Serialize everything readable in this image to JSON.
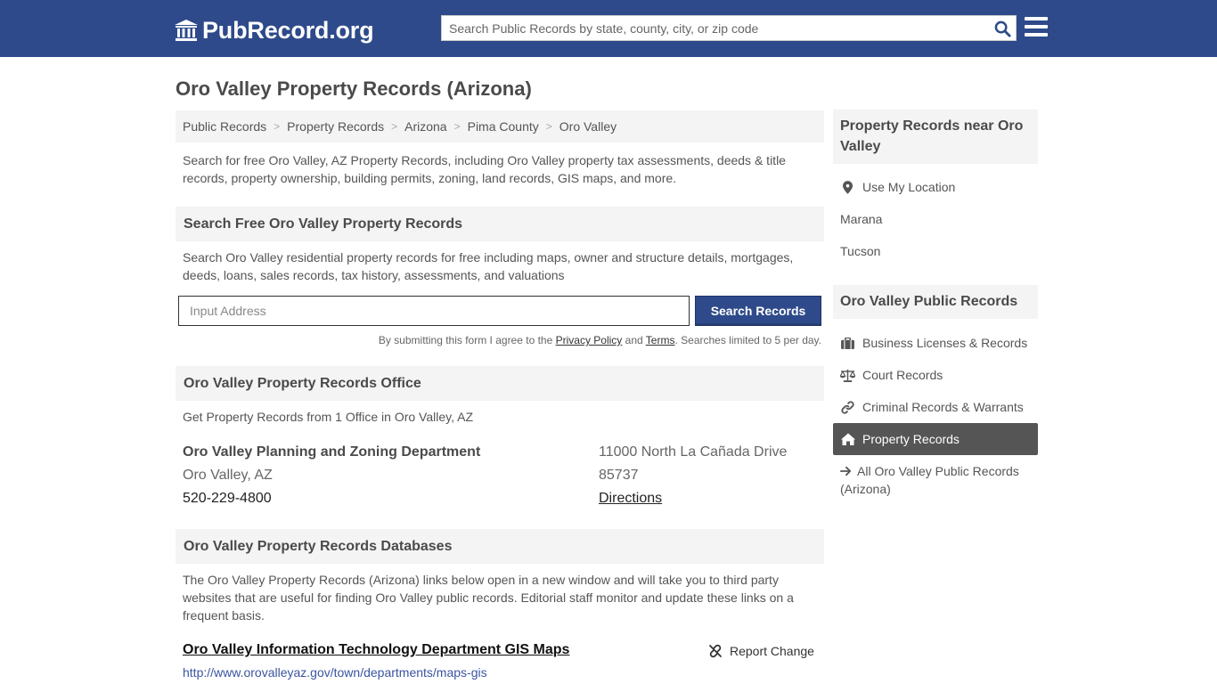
{
  "header": {
    "logo_text": "PubRecord.org",
    "search_placeholder": "Search Public Records by state, county, city, or zip code",
    "brand_color": "#2e4a8a"
  },
  "page": {
    "title": "Oro Valley Property Records (Arizona)",
    "breadcrumb": [
      "Public Records",
      "Property Records",
      "Arizona",
      "Pima County",
      "Oro Valley"
    ],
    "intro_line1": "Search for free Oro Valley, AZ Property Records, including Oro Valley property tax assessments, deeds & title",
    "intro_line2": "records, property ownership, building permits, zoning, land records, GIS maps, and more."
  },
  "search_section": {
    "heading": "Search Free Oro Valley Property Records",
    "desc_line1": "Search Oro Valley residential property records for free including maps, owner and structure details, mortgages,",
    "desc_line2": "deeds, loans, sales records, tax history, assessments, and valuations",
    "address_placeholder": "Input Address",
    "button_label": "Search Records",
    "disclaimer_prefix": "By submitting this form I agree to the",
    "privacy_label": "Privacy Policy",
    "and_text": "and",
    "terms_label": "Terms",
    "disclaimer_suffix": ". Searches limited to 5 per day."
  },
  "office_section": {
    "heading": "Oro Valley Property Records Office",
    "subtext": "Get Property Records from 1 Office in Oro Valley, AZ",
    "office": {
      "name": "Oro Valley Planning and Zoning Department",
      "city": "Oro Valley, AZ",
      "phone": "520-229-4800",
      "street": "11000 North La Cañada Drive",
      "zip": "85737",
      "directions_label": "Directions"
    }
  },
  "databases_section": {
    "heading": "Oro Valley Property Records Databases",
    "desc_line1": "The Oro Valley Property Records (Arizona) links below open in a new window and will take you to third party",
    "desc_line2": "websites that are useful for finding Oro Valley public records. Editorial staff monitor and update these links on a",
    "desc_line3": "frequent basis.",
    "link_title": "Oro Valley Information Technology Department GIS Maps",
    "link_url": "http://www.orovalleyaz.gov/town/departments/maps-gis",
    "report_label": "Report Change"
  },
  "sidebar": {
    "nearby_heading_line1": "Property Records near Oro",
    "nearby_heading_line2": "Valley",
    "use_location": "Use My Location",
    "nearby": [
      "Marana",
      "Tucson"
    ],
    "public_heading": "Oro Valley Public Records",
    "links": [
      {
        "label": "Business Licenses & Records",
        "icon": "briefcase-icon"
      },
      {
        "label": "Court Records",
        "icon": "scale-icon"
      },
      {
        "label": "Criminal Records & Warrants",
        "icon": "link-icon"
      },
      {
        "label": "Property Records",
        "icon": "home-icon",
        "active": true
      }
    ],
    "all_line1": "All Oro Valley Public Records",
    "all_line2": "(Arizona)"
  }
}
